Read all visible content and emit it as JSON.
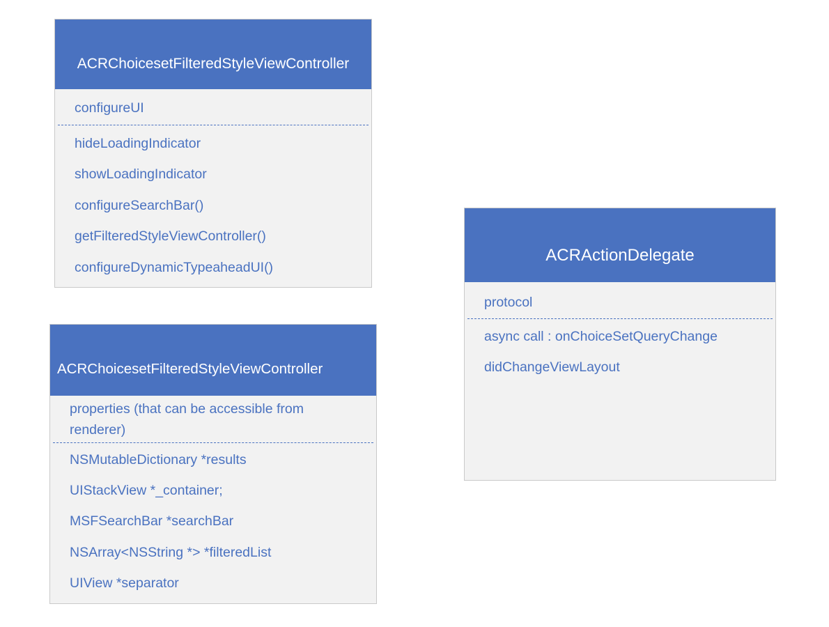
{
  "diagram": {
    "boxes": [
      {
        "title": "ACRChoicesetFilteredStyleViewController",
        "section": "configureUI",
        "members": [
          "hideLoadingIndicator",
          "showLoadingIndicator",
          "configureSearchBar()",
          "getFilteredStyleViewController()",
          "configureDynamicTypeaheadUI()"
        ]
      },
      {
        "title": "ACRChoicesetFilteredStyleViewController",
        "section_line1": "properties (that can be accessible from",
        "section_line2": "renderer)",
        "members": [
          "NSMutableDictionary *results",
          "UIStackView *_container;",
          "MSFSearchBar *searchBar",
          "NSArray<NSString *> *filteredList",
          "UIView *separator"
        ]
      },
      {
        "title": "ACRActionDelegate",
        "section": "protocol",
        "members": [
          "async call : onChoiceSetQueryChange",
          "didChangeViewLayout"
        ]
      }
    ],
    "colors": {
      "header": "#4a72c0",
      "text": "#4a72c0",
      "body": "#f2f2f2",
      "border": "#c9c9c9"
    }
  }
}
